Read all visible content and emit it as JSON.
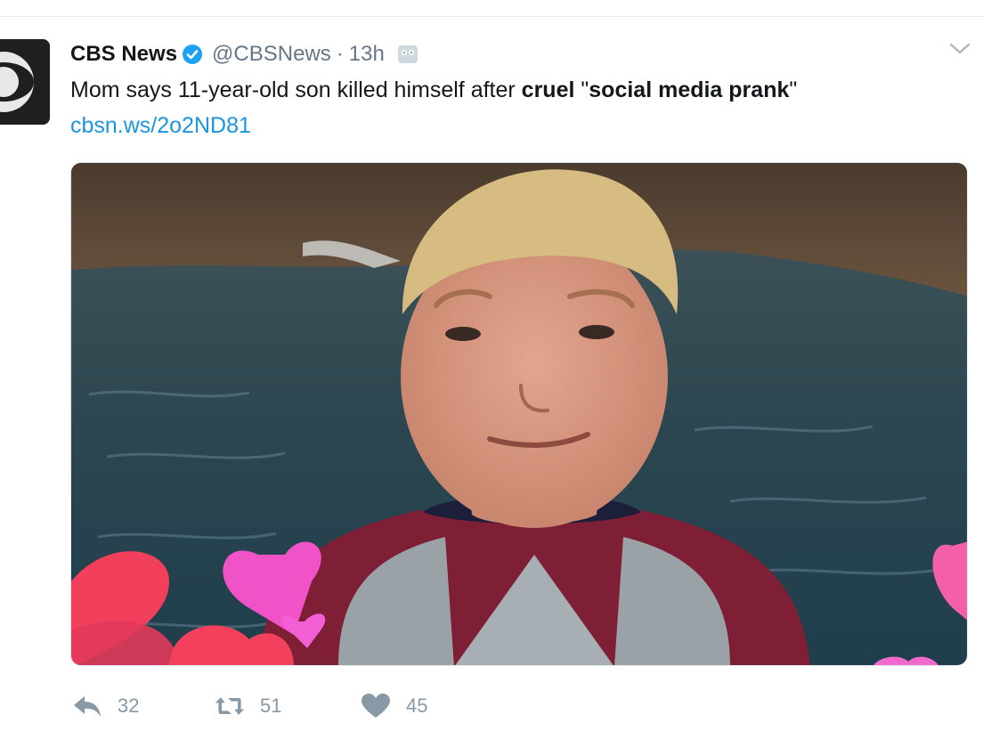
{
  "tweet": {
    "author_name": "CBS News",
    "handle": "@CBSNews",
    "separator": "·",
    "time": "13h",
    "text": {
      "part1": "Mom says 11-year-old son killed himself after ",
      "bold1": "cruel",
      "part2": " \"",
      "bold2": "social media prank",
      "part3": "\""
    },
    "link": "cbsn.ws/2o2ND81"
  },
  "actions": {
    "reply_count": "32",
    "retweet_count": "51",
    "like_count": "45"
  },
  "icons": {
    "avatar": "cbs-eye-logo",
    "verified": "verified-badge-icon",
    "ghost": "ghost-icon",
    "caret": "chevron-down-icon",
    "reply": "reply-icon",
    "retweet": "retweet-icon",
    "like": "heart-icon"
  },
  "colors": {
    "link": "#1b95e0",
    "muted": "#657786",
    "action": "#8899a6",
    "verified": "#1da1f2"
  }
}
